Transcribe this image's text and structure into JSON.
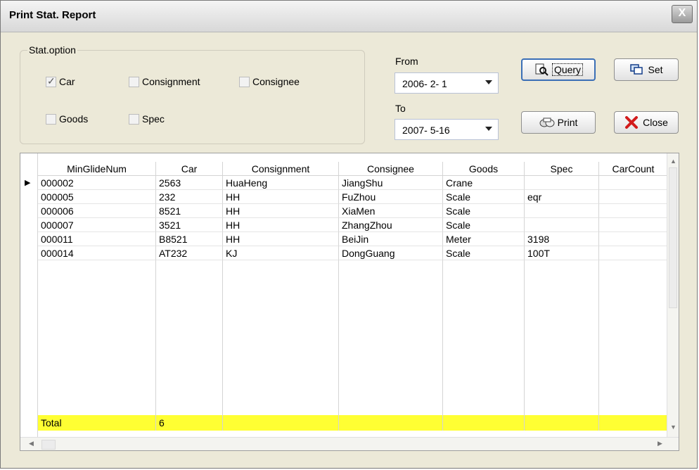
{
  "window": {
    "title": "Print Stat. Report",
    "close_glyph": "X"
  },
  "stat_option": {
    "label": "Stat.option",
    "options": [
      {
        "label": "Car",
        "checked": true
      },
      {
        "label": "Consignment",
        "checked": false
      },
      {
        "label": "Consignee",
        "checked": false
      },
      {
        "label": "Goods",
        "checked": false
      },
      {
        "label": "Spec",
        "checked": false
      }
    ]
  },
  "dates": {
    "from_label": "From",
    "from_value": "2006- 2- 1",
    "to_label": "To",
    "to_value": "2007- 5-16"
  },
  "buttons": {
    "query": "Query",
    "set": "Set",
    "print": "Print",
    "close": "Close"
  },
  "grid": {
    "columns": [
      "MinGlideNum",
      "Car",
      "Consignment",
      "Consignee",
      "Goods",
      "Spec",
      "CarCount"
    ],
    "rows": [
      [
        "000002",
        "2563",
        "HuaHeng",
        "JiangShu",
        "Crane",
        "",
        ""
      ],
      [
        "000005",
        "232",
        "HH",
        "FuZhou",
        "Scale",
        "eqr",
        ""
      ],
      [
        "000006",
        "8521",
        "HH",
        "XiaMen",
        "Scale",
        "",
        ""
      ],
      [
        "000007",
        "3521",
        "HH",
        "ZhangZhou",
        "Scale",
        "",
        ""
      ],
      [
        "000011",
        "B8521",
        "HH",
        "BeiJin",
        "Meter",
        "3198",
        ""
      ],
      [
        "000014",
        "AT232",
        "KJ",
        "DongGuang",
        "Scale",
        "100T",
        ""
      ]
    ],
    "total": {
      "label": "Total",
      "value": "6"
    },
    "total_color": "#ffff33",
    "current_row_marker": "▶"
  }
}
